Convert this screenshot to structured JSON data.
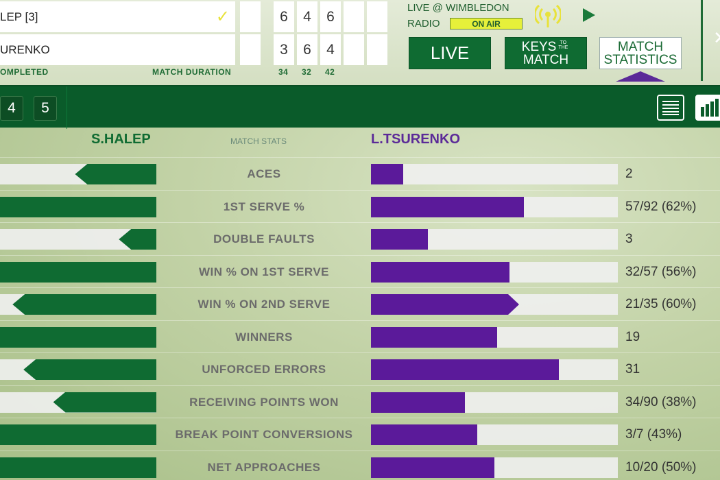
{
  "scoreboard": {
    "player1": {
      "name": "LEP [3]",
      "sets": [
        "6",
        "4",
        "6"
      ]
    },
    "player2": {
      "name": "URENKO",
      "sets": [
        "3",
        "6",
        "4"
      ]
    },
    "status": "OMPLETED",
    "duration_label": "MATCH DURATION",
    "durations": [
      "34",
      "32",
      "42"
    ],
    "radio_line1": "LIVE @ WIMBLEDON",
    "radio_line2": "RADIO",
    "on_air": "ON AIR",
    "check_icon": "✓"
  },
  "nav": {
    "live": "LIVE",
    "keys_top": "KEYS",
    "keys_small": "TO THE",
    "keys_bottom": "MATCH",
    "stats_line1": "MATCH",
    "stats_line2": "STATISTICS"
  },
  "toolbar": {
    "set_tabs": [
      "4",
      "5"
    ]
  },
  "stats": {
    "player1": "S.HALEP",
    "header_mid": "MATCH STATS",
    "player2": "L.TSURENKO",
    "colors": {
      "p1": "#0f6b32",
      "p2": "#5b1a9a"
    },
    "rows": [
      {
        "label": "ACES",
        "p1_fraction": 0.52,
        "p2_fraction": 0.13,
        "p2_value": "2"
      },
      {
        "label": "1ST SERVE %",
        "p1_fraction": 1.0,
        "p2_fraction": 0.62,
        "p2_value": "57/92 (62%)"
      },
      {
        "label": "DOUBLE FAULTS",
        "p1_fraction": 0.24,
        "p2_fraction": 0.23,
        "p2_value": "3"
      },
      {
        "label": "WIN % ON 1ST SERVE",
        "p1_fraction": 1.0,
        "p2_fraction": 0.56,
        "p2_value": "32/57 (56%)"
      },
      {
        "label": "WIN % ON 2ND SERVE",
        "p1_fraction": 0.92,
        "p2_fraction": 0.6,
        "p2_value": "21/35 (60%)",
        "p2_arrow": true
      },
      {
        "label": "WINNERS",
        "p1_fraction": 1.0,
        "p2_fraction": 0.51,
        "p2_value": "19"
      },
      {
        "label": "UNFORCED ERRORS",
        "p1_fraction": 0.85,
        "p2_fraction": 0.76,
        "p2_value": "31"
      },
      {
        "label": "RECEIVING POINTS WON",
        "p1_fraction": 0.66,
        "p2_fraction": 0.38,
        "p2_value": "34/90 (38%)"
      },
      {
        "label": "BREAK POINT CONVERSIONS",
        "p1_fraction": 1.0,
        "p2_fraction": 0.43,
        "p2_value": "3/7 (43%)"
      },
      {
        "label": "NET APPROACHES",
        "p1_fraction": 1.0,
        "p2_fraction": 0.5,
        "p2_value": "10/20 (50%)"
      }
    ]
  }
}
